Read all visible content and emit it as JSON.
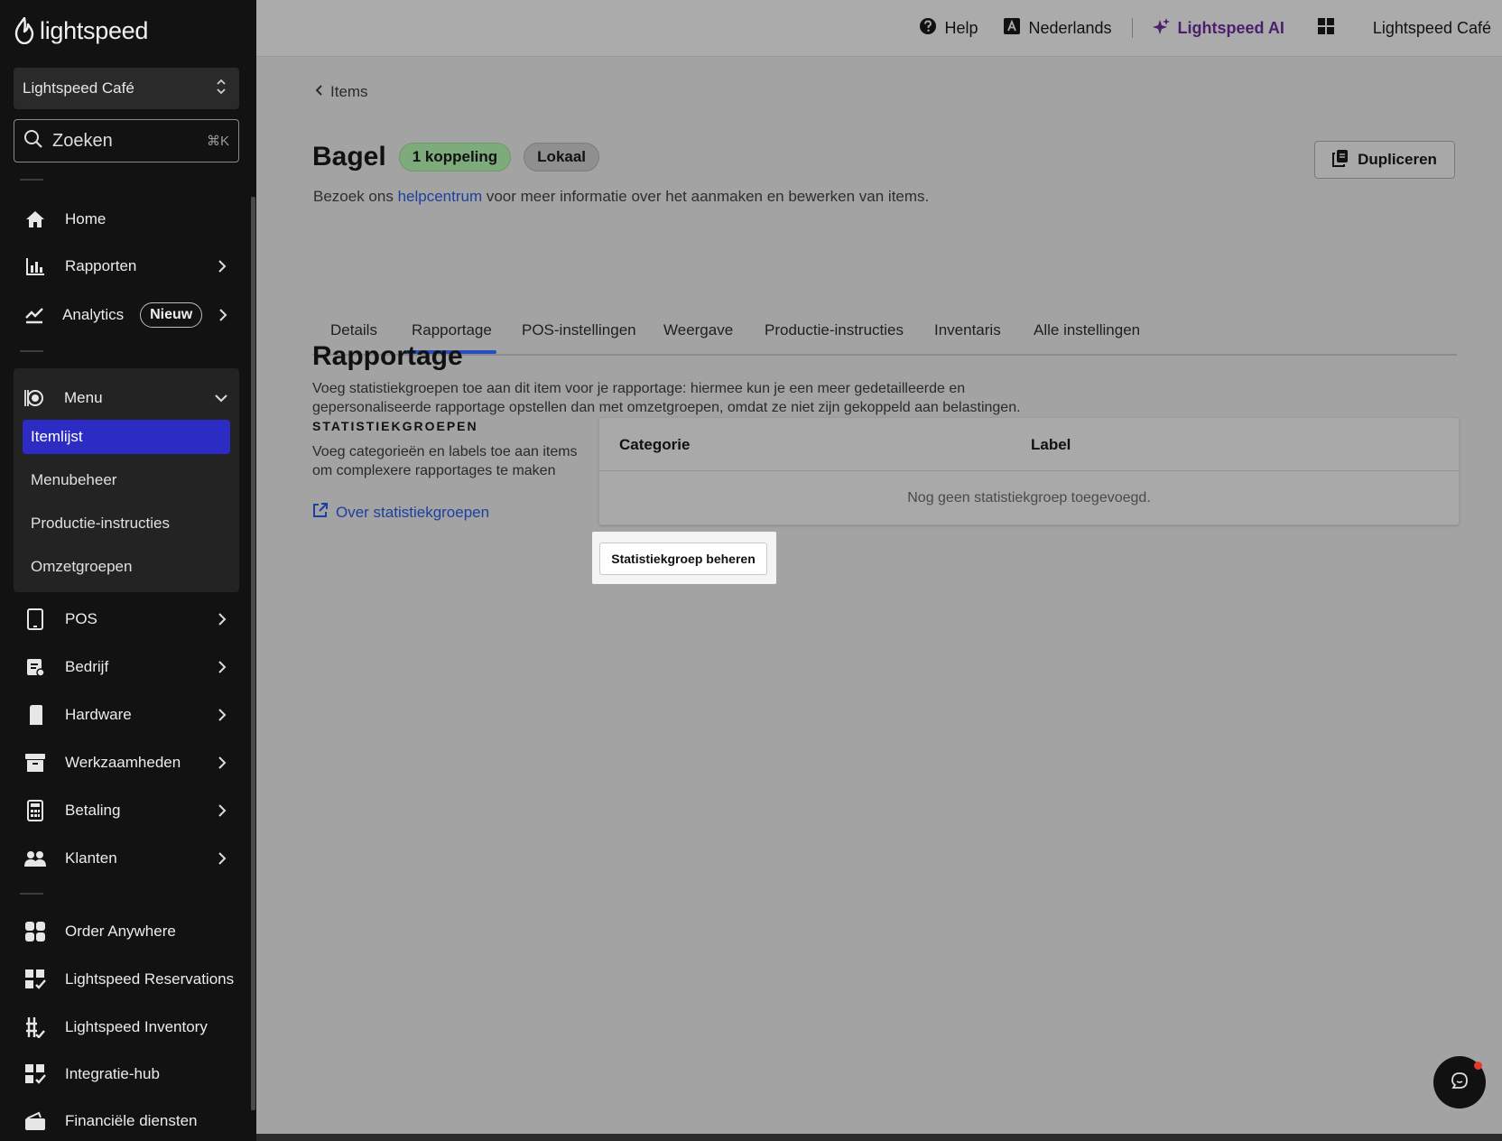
{
  "sidebar": {
    "brand": "lightspeed",
    "store": "Lightspeed Café",
    "search": {
      "label": "Zoeken",
      "shortcut": "⌘K"
    },
    "items": [
      {
        "label": "Home"
      },
      {
        "label": "Rapporten"
      },
      {
        "label": "Analytics",
        "badge": "Nieuw"
      },
      {
        "label": "Menu"
      },
      {
        "label": "POS"
      },
      {
        "label": "Bedrijf"
      },
      {
        "label": "Hardware"
      },
      {
        "label": "Werkzaamheden"
      },
      {
        "label": "Betaling"
      },
      {
        "label": "Klanten"
      },
      {
        "label": "Order Anywhere"
      },
      {
        "label": "Lightspeed Reservations"
      },
      {
        "label": "Lightspeed Inventory"
      },
      {
        "label": "Integratie-hub"
      },
      {
        "label": "Financiële diensten"
      }
    ],
    "menu_sub": [
      {
        "label": "Itemlijst"
      },
      {
        "label": "Menubeheer"
      },
      {
        "label": "Productie-instructies"
      },
      {
        "label": "Omzetgroepen"
      }
    ]
  },
  "topbar": {
    "help": "Help",
    "language": "Nederlands",
    "ai": "Lightspeed AI",
    "account": "Lightspeed Café"
  },
  "page": {
    "breadcrumb": "Items",
    "title": "Bagel",
    "badge_link": "1 koppeling",
    "badge_local": "Lokaal",
    "duplicate": "Dupliceren",
    "help_prefix": "Bezoek ons ",
    "help_link": "helpcentrum",
    "help_suffix": " voor meer informatie over het aanmaken en bewerken van items.",
    "tabs": [
      "Details",
      "Rapportage",
      "POS-instellingen",
      "Weergave",
      "Productie-instructies",
      "Inventaris",
      "Alle instellingen"
    ],
    "active_tab": "Rapportage",
    "section_title": "Rapportage",
    "section_desc": "Voeg statistiekgroepen toe aan dit item voor je rapportage: hiermee kun je een meer gedetailleerde en gepersonaliseerde rapportage opstellen dan met omzetgroepen, omdat ze niet zijn gekoppeld aan belastingen.",
    "stat_heading": "STATISTIEKGROEPEN",
    "stat_desc": "Voeg categorieën en labels toe aan items om complexere rapportages te maken",
    "stat_link": "Over statistiekgroepen",
    "table": {
      "columns": [
        "Categorie",
        "Label"
      ],
      "empty": "Nog geen statistiekgroep toegevoegd."
    },
    "manage_button": "Statistiekgroep beheren"
  },
  "colors": {
    "sidebar_bg": "#121212",
    "active_item": "#2c2cc5",
    "link": "#1d3fa0",
    "ai_accent": "#4b1e6e",
    "tab_underline": "#2a4ec1",
    "badge_green": "#7eab7b",
    "notification_dot": "#e23a2e"
  },
  "icons": {
    "topbar": [
      "help-icon",
      "language-icon",
      "ai-sparkle-icon",
      "apps-grid-icon"
    ],
    "chat": "chat-icon"
  }
}
